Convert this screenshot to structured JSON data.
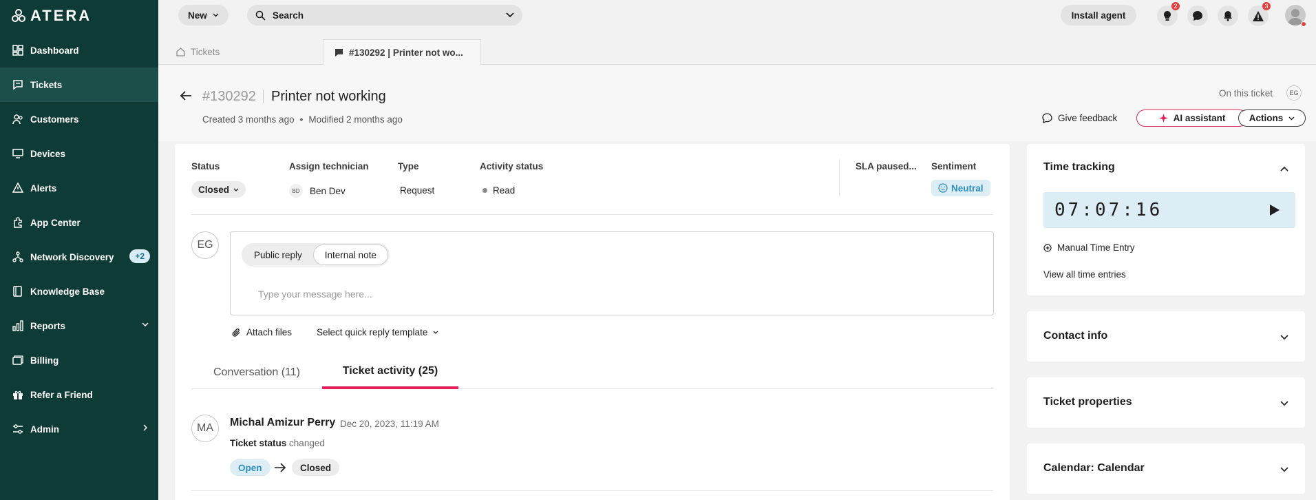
{
  "brand": {
    "logo_text": "ATERA",
    "accent": "#e61e5a",
    "sidebar_bg": "#0e3b36"
  },
  "sidebar": {
    "items": [
      {
        "label": "Dashboard",
        "icon": "dashboard-icon"
      },
      {
        "label": "Tickets",
        "icon": "tickets-icon",
        "active": true
      },
      {
        "label": "Customers",
        "icon": "customers-icon"
      },
      {
        "label": "Devices",
        "icon": "devices-icon"
      },
      {
        "label": "Alerts",
        "icon": "alerts-icon"
      },
      {
        "label": "App Center",
        "icon": "app-center-icon"
      },
      {
        "label": "Network Discovery",
        "icon": "network-icon",
        "badge": "+2"
      },
      {
        "label": "Knowledge Base",
        "icon": "knowledge-base-icon"
      },
      {
        "label": "Reports",
        "icon": "reports-icon"
      },
      {
        "label": "Billing",
        "icon": "billing-icon"
      },
      {
        "label": "Refer a Friend",
        "icon": "gift-icon"
      },
      {
        "label": "Admin",
        "icon": "admin-icon"
      }
    ]
  },
  "topbar": {
    "new_label": "New",
    "search_label": "Search",
    "install_label": "Install agent",
    "notifications": [
      {
        "icon": "lightbulb-icon",
        "badge": "2"
      },
      {
        "icon": "chat-icon",
        "badge": ""
      },
      {
        "icon": "bell-icon",
        "badge": ""
      },
      {
        "icon": "warning-icon",
        "badge": "3"
      }
    ]
  },
  "tabs": {
    "tickets_label": "Tickets",
    "current_label": "#130292 | Printer not wo..."
  },
  "ticket": {
    "number": "#130292",
    "title": "Printer not working",
    "created": "Created 3 months ago",
    "bullet": "•",
    "modified": "Modified 2 months ago",
    "on_this_ticket": "On this ticket",
    "viewer_initials": "EG",
    "feedback_label": "Give feedback",
    "ai_label": "AI assistant",
    "actions_label": "Actions"
  },
  "fields": {
    "status_label": "Status",
    "status_value": "Closed",
    "tech_label": "Assign technician",
    "tech_initials": "BD",
    "tech_value": "Ben Dev",
    "type_label": "Type",
    "type_value": "Request",
    "activity_label": "Activity status",
    "activity_value": "Read",
    "sla_label": "SLA paused...",
    "sentiment_label": "Sentiment",
    "sentiment_value": "Neutral"
  },
  "reply": {
    "author_initials": "EG",
    "public_label": "Public reply",
    "internal_label": "Internal note",
    "placeholder": "Type your message here...",
    "attach_label": "Attach files",
    "quick_label": "Select quick reply template"
  },
  "conversation": {
    "tab_conversation": "Conversation (11)",
    "tab_activity": "Ticket activity (25)"
  },
  "activity": {
    "initials": "MA",
    "name": "Michal Amizur Perry",
    "date": "Dec 20, 2023, 11:19 AM",
    "desc_bold": "Ticket status",
    "desc_rest": " changed",
    "from": "Open",
    "to": "Closed"
  },
  "right": {
    "time_tracking_title": "Time tracking",
    "timer": "07:07:16",
    "manual_label": "Manual Time Entry",
    "view_all_label": "View all time entries",
    "contact_title": "Contact info",
    "properties_title": "Ticket properties",
    "calendar_title": "Calendar: Calendar"
  }
}
